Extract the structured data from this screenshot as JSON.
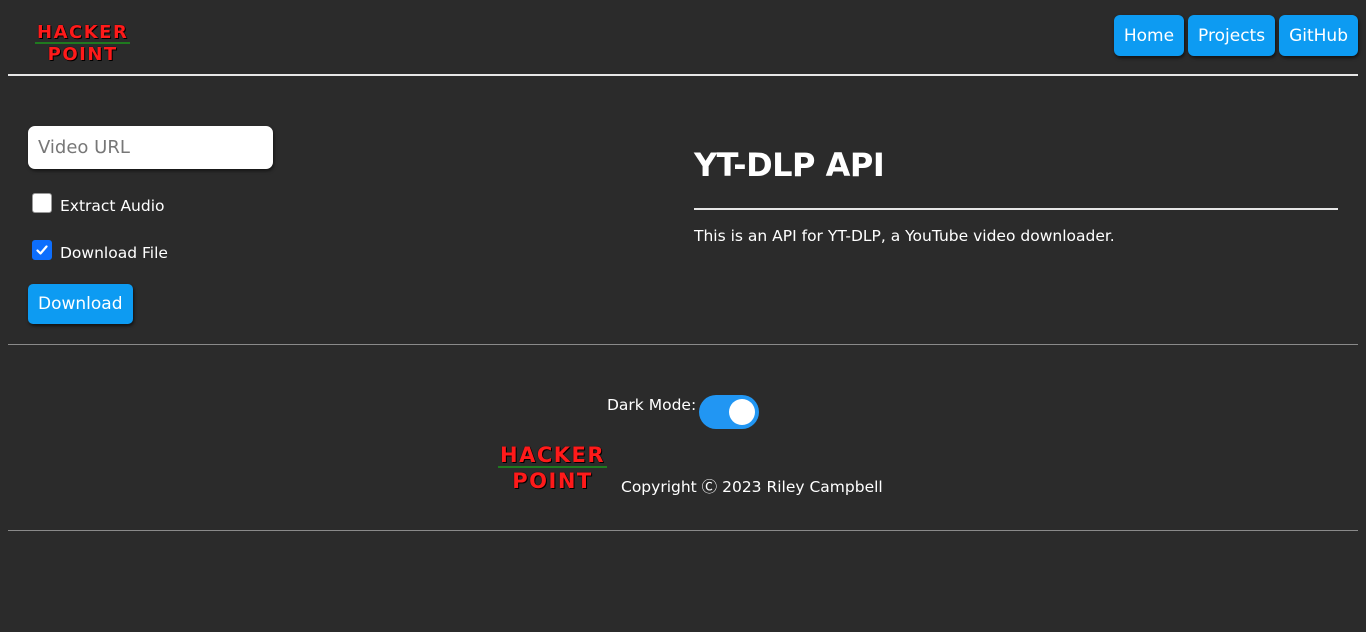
{
  "header": {
    "logo": {
      "line1": "HACKER",
      "line2": "POINT"
    },
    "nav": [
      {
        "label": "Home"
      },
      {
        "label": "Projects"
      },
      {
        "label": "GitHub"
      }
    ]
  },
  "form": {
    "url_placeholder": "Video URL",
    "url_value": "",
    "extract_audio": {
      "label": "Extract Audio",
      "checked": false
    },
    "download_file": {
      "label": "Download File",
      "checked": true
    },
    "download_button": "Download"
  },
  "content": {
    "title": "YT-DLP API",
    "description": "This is an API for YT-DLP, a YouTube video downloader."
  },
  "footer": {
    "dark_mode_label": "Dark Mode:",
    "dark_mode_on": true,
    "logo": {
      "line1": "HACKER",
      "line2": "POINT"
    },
    "copyright": "Copyright Ⓒ 2023 Riley Campbell"
  },
  "colors": {
    "background": "#2b2b2b",
    "accent": "#0d9bf2",
    "toggle": "#2196f3",
    "logo_red": "#ff1a1a"
  }
}
